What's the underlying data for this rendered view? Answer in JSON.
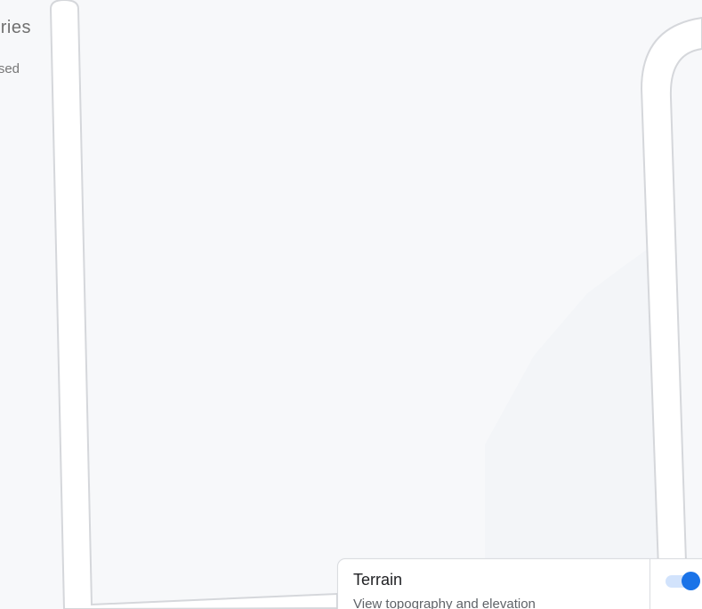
{
  "map": {
    "background": "#f7f8fa",
    "road_fill": "#ffffff",
    "road_outline": "#d5d7db"
  },
  "left_panel": {
    "title": "ries",
    "subtitle": "sed"
  },
  "layer_card": {
    "title": "Terrain",
    "description": "View topography and elevation",
    "toggle_on": true,
    "accent": "#1a73e8"
  }
}
